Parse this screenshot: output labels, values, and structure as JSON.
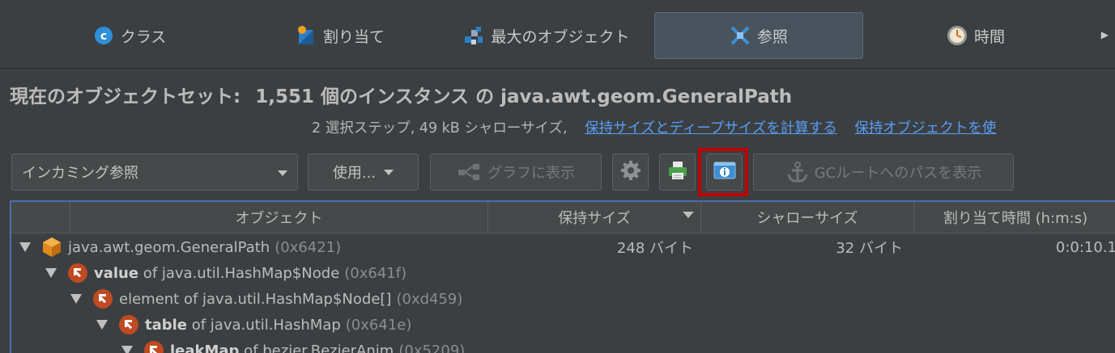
{
  "tabs": [
    {
      "label": "クラス",
      "icon": "class-icon"
    },
    {
      "label": "割り当て",
      "icon": "allocation-icon"
    },
    {
      "label": "最大のオブジェクト",
      "icon": "biggest-objects-icon"
    },
    {
      "label": "参照",
      "icon": "references-icon",
      "active": true
    },
    {
      "label": "時間",
      "icon": "time-icon"
    }
  ],
  "headline": {
    "prefix": "現在のオブジェクトセット:",
    "count": "1,551 個のインスタンス の java.awt.geom.GeneralPath"
  },
  "subline": {
    "text": "2 選択ステップ, 49 kB シャローサイズ,",
    "link1": "保持サイズとディープサイズを計算する",
    "link2": "保持オブジェクトを使"
  },
  "toolbar": {
    "view_select": "インカミング参照",
    "use_button": "使用...",
    "graph_button": "グラフに表示",
    "gc_button": "GCルートへのパスを表示"
  },
  "table": {
    "headers": [
      "オブジェクト",
      "保持サイズ",
      "シャローサイズ",
      "割り当て時間 (h:m:s)"
    ],
    "rows": [
      {
        "bold": "",
        "name": "java.awt.geom.GeneralPath",
        "addr": "(0x6421)",
        "retained": "248 バイト",
        "shallow": "32 バイト",
        "time": "0:0:10.1"
      },
      {
        "bold": "value",
        "name": " of java.util.HashMap$Node",
        "addr": "(0x641f)"
      },
      {
        "bold": "",
        "name": "element of java.util.HashMap$Node[]",
        "addr": "(0xd459)"
      },
      {
        "bold": "table",
        "name": " of java.util.HashMap",
        "addr": "(0x641e)"
      },
      {
        "bold": "leakMap",
        "name": " of bezier.BezierAnim",
        "addr": "(0x5209)"
      }
    ]
  },
  "colors": {
    "background": "#3c3f41",
    "link": "#589df6",
    "highlight": "#c00000",
    "selection_border": "#4b6eaf"
  }
}
